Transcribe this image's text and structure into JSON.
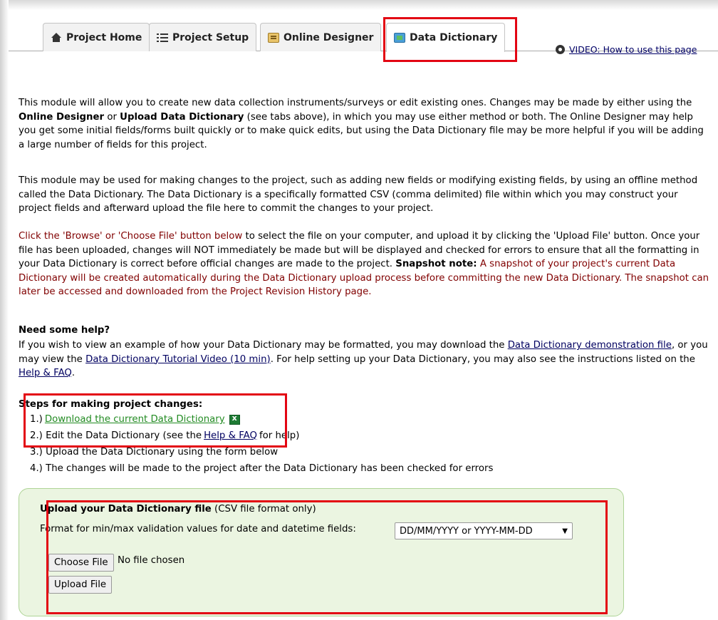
{
  "tabs": [
    {
      "label": "Project Home",
      "icon": "home-icon"
    },
    {
      "label": "Project Setup",
      "icon": "list-icon"
    },
    {
      "label": "Online Designer",
      "icon": "designer-icon"
    },
    {
      "label": "Data Dictionary",
      "icon": "data-dictionary-icon",
      "active": true
    }
  ],
  "video_link": "VIDEO: How to use this page",
  "intro": {
    "p1_a": "This module will allow you to create new data collection instruments/surveys or edit existing ones. Changes may be made by either using the ",
    "p1_b": "Online Designer",
    "p1_c": " or ",
    "p1_d": "Upload Data Dictionary",
    "p1_e": " (see tabs above), in which you may use either method or both. The Online Designer may help you get some initial fields/forms built quickly or to make quick edits, but using the Data Dictionary file may be more helpful if you will be adding a large number of fields for this project.",
    "p2": "This module may be used for making changes to the project, such as adding new fields or modifying existing fields, by using an offline method called the Data Dictionary. The Data Dictionary is a specifically formatted CSV (comma delimited) file within which you may construct your project fields and afterward upload the file here to commit the changes to your project.",
    "p3_a": "Click the 'Browse' or 'Choose File' button below",
    "p3_b": " to select the file on your computer, and upload it by clicking the 'Upload File' button. Once your file has been uploaded, changes will NOT immediately be made but will be displayed and checked for errors to ensure that all the formatting in your Data Dictionary is correct before official changes are made to the project. ",
    "p3_c": "Snapshot note:",
    "p3_d": " A snapshot of your project's current Data Dictionary will be created automatically during the Data Dictionary upload process before committing the new Data Dictionary. The snapshot can later be accessed and downloaded from the Project Revision History page."
  },
  "help": {
    "heading": "Need some help?",
    "t1": "If you wish to view an example of how your Data Dictionary may be formatted, you may download the ",
    "link1": "Data Dictionary demonstration file",
    "t2": ", or you may view the ",
    "link2": "Data Dictionary Tutorial Video (10 min)",
    "t3": ". For help setting up your Data Dictionary, you may also see the instructions listed on the ",
    "link3": "Help & FAQ",
    "t4": "."
  },
  "steps": {
    "heading": "Steps for making project changes:",
    "s1_prefix": "1.) ",
    "s1_link": "Download the current Data Dictionary",
    "s2_prefix": "2.) Edit the Data Dictionary (see the ",
    "s2_link": "Help & FAQ",
    "s2_suffix": " for help)",
    "s3": "3.) Upload the Data Dictionary using the form below",
    "s4": "4.) The changes will be made to the project after the Data Dictionary has been checked for errors"
  },
  "upload": {
    "title_bold": "Upload your Data Dictionary file",
    "title_rest": " (CSV file format only)",
    "format_label": "Format for min/max validation values for date and datetime fields:",
    "format_value": "DD/MM/YYYY or YYYY-MM-DD",
    "choose_label": "Choose File",
    "no_file": "No file chosen",
    "upload_label": "Upload File"
  },
  "colors": {
    "highlight": "#e30613",
    "panel_bg": "#ebf5e1",
    "red_text": "#800000",
    "green_link": "#228b22"
  }
}
